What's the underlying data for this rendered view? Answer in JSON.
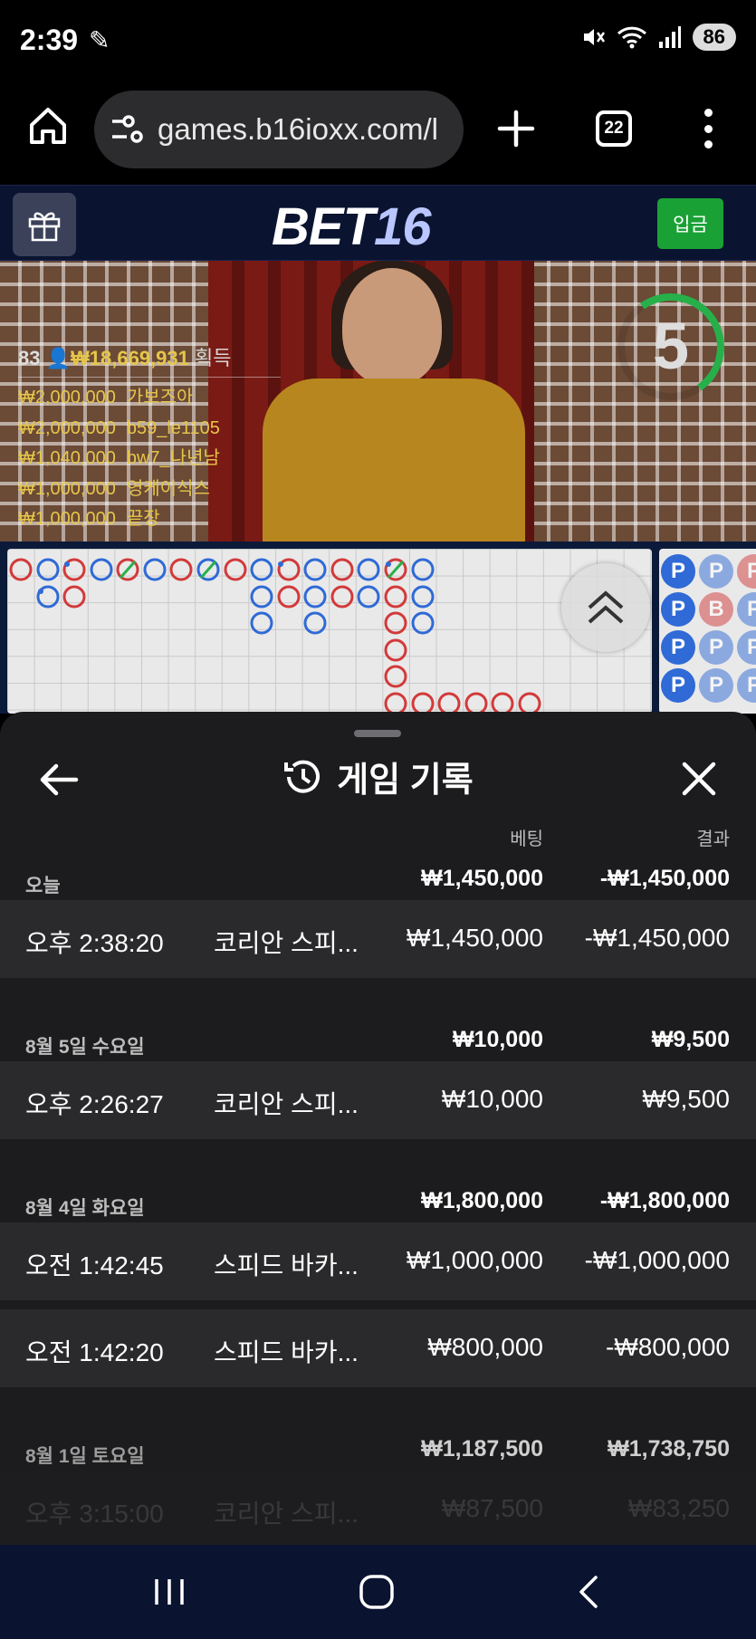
{
  "status_bar": {
    "time": "2:39",
    "battery": "86",
    "icons": [
      "feather-icon",
      "mute-icon",
      "wifi-icon",
      "signal-icon",
      "battery-icon"
    ]
  },
  "browser": {
    "url": "games.b16ioxx.com/l",
    "tab_count": "22"
  },
  "site": {
    "logo_part1": "BET",
    "logo_part2": "16",
    "deposit_label": "입금"
  },
  "video": {
    "round_timer": "5",
    "winners_count": "83",
    "winners_total": "₩18,669,931",
    "winners_total_label": "획득",
    "winners": [
      {
        "amount": "₩2,000,000",
        "name": "가보즈아"
      },
      {
        "amount": "₩2,000,000",
        "name": "b59_le1105"
      },
      {
        "amount": "₩1,040,000",
        "name": "bw7_나년남"
      },
      {
        "amount": "₩1,000,000",
        "name": "영케이식스"
      },
      {
        "amount": "₩1,000,000",
        "name": "끝장"
      }
    ]
  },
  "bead_road": [
    [
      "P",
      "P",
      "P"
    ],
    [
      "P",
      "B",
      "P"
    ],
    [
      "P",
      "P",
      "P"
    ],
    [
      "P",
      "P",
      "P"
    ]
  ],
  "history": {
    "title": "게임 기록",
    "col_bet": "베팅",
    "col_result": "결과",
    "groups": [
      {
        "date": "오늘",
        "total_bet": "₩1,450,000",
        "total_result": "-₩1,450,000",
        "items": [
          {
            "time": "오후 2:38:20",
            "game": "코리안 스피...",
            "bet": "₩1,450,000",
            "result": "-₩1,450,000"
          }
        ]
      },
      {
        "date": "8월 5일 수요일",
        "total_bet": "₩10,000",
        "total_result": "₩9,500",
        "items": [
          {
            "time": "오후 2:26:27",
            "game": "코리안 스피...",
            "bet": "₩10,000",
            "result": "₩9,500"
          }
        ]
      },
      {
        "date": "8월 4일 화요일",
        "total_bet": "₩1,800,000",
        "total_result": "-₩1,800,000",
        "items": [
          {
            "time": "오전 1:42:45",
            "game": "스피드 바카...",
            "bet": "₩1,000,000",
            "result": "-₩1,000,000"
          },
          {
            "time": "오전 1:42:20",
            "game": "스피드 바카...",
            "bet": "₩800,000",
            "result": "-₩800,000"
          }
        ]
      },
      {
        "date": "8월 1일 토요일",
        "total_bet": "₩1,187,500",
        "total_result": "₩1,738,750",
        "items": [
          {
            "time": "오후 3:15:00",
            "game": "코리안 스피...",
            "bet": "₩87,500",
            "result": "₩83,250"
          }
        ]
      }
    ]
  },
  "nav": {
    "icons": [
      "recent-apps-icon",
      "home-icon",
      "back-icon"
    ]
  },
  "colors": {
    "banker": "#d23a3a",
    "player": "#2f6ad6",
    "tie": "#27b04a",
    "deposit": "#1aa136",
    "header_bg": "#0a1330",
    "sheet_bg": "#1c1c1e"
  }
}
